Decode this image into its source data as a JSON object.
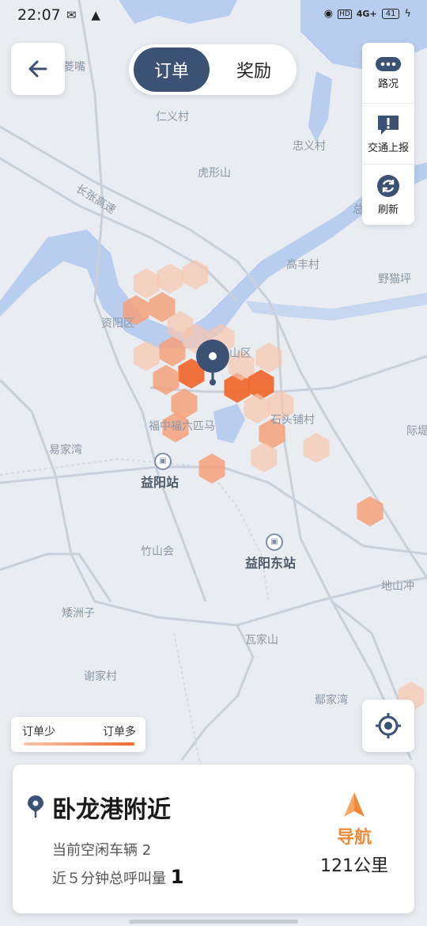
{
  "status_bar": {
    "time": "22:07",
    "left_icons": [
      "notification-icon",
      "warning-icon"
    ],
    "network": "4G+",
    "battery": "41"
  },
  "header": {
    "tabs": [
      {
        "label": "订单",
        "active": true
      },
      {
        "label": "奖励",
        "active": false
      }
    ]
  },
  "right_panel": {
    "items": [
      {
        "label": "路况",
        "icon": "more-dots-icon"
      },
      {
        "label": "交通上报",
        "icon": "report-icon"
      },
      {
        "label": "刷新",
        "icon": "refresh-icon"
      }
    ]
  },
  "map": {
    "labels": {
      "renyicun": "仁义村",
      "zhongyicun": "忠义村",
      "huxingshan": "虎形山",
      "changzhang": "长张高速",
      "gaofengcun": "高丰村",
      "yemaoping": "野猫坪",
      "ziyangqu": "资阳区",
      "heshanqu": "山区",
      "fuzhong": "福中福六匹马",
      "shitoupu": "石头铺村",
      "yijiawan": "易家湾",
      "yiyangzhan": "益阳站",
      "zhushanhui": "竹山会",
      "yiyangdongzhan": "益阳东站",
      "aizhouzi": "矮洲子",
      "wajiashan": "瓦家山",
      "xiejiacun": "谢家村",
      "ejiawan": "鄢家湾",
      "dishan": "地山冲",
      "lingzui": "菱嘴",
      "zong": "总",
      "jiwu": "际堤"
    },
    "heat_colors": {
      "low": "#f7c6ae",
      "mid": "#f5a07a",
      "high": "#f06a30"
    }
  },
  "legend": {
    "low_label": "订单少",
    "high_label": "订单多"
  },
  "bottom_card": {
    "title": "卧龙港附近",
    "idle_vehicles": "当前空闲车辆 2",
    "calls_prefix": "近５分钟总呼叫量",
    "calls_value": "1",
    "nav_label": "导航",
    "distance": "121公里"
  },
  "colors": {
    "accent": "#3b5275",
    "nav": "#f08a3a"
  }
}
